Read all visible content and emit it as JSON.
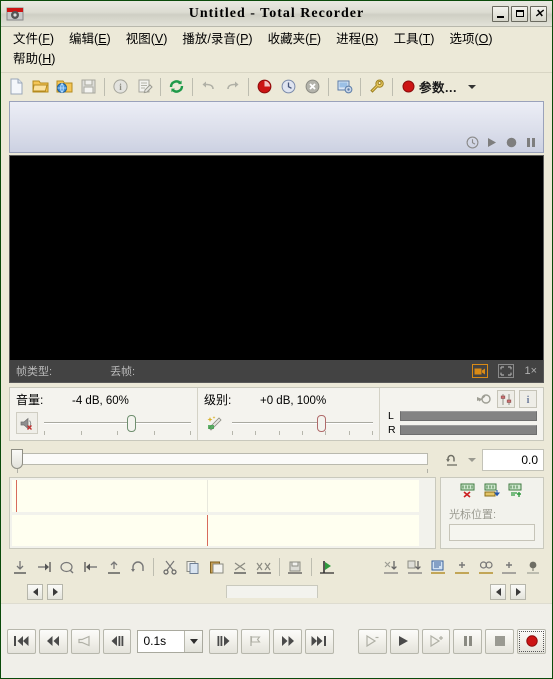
{
  "window": {
    "title": "Untitled - Total Recorder",
    "app_icon": "recorder-icon",
    "buttons": {
      "minimize": "_",
      "maximize": "□",
      "close": "✕"
    }
  },
  "menubar": {
    "items": [
      {
        "label": "文件",
        "accel": "F"
      },
      {
        "label": "编辑",
        "accel": "E"
      },
      {
        "label": "视图",
        "accel": "V"
      },
      {
        "label": "播放/录音",
        "accel": "P"
      },
      {
        "label": "收藏夹",
        "accel": "F"
      },
      {
        "label": "进程",
        "accel": "R"
      },
      {
        "label": "工具",
        "accel": "T"
      },
      {
        "label": "选项",
        "accel": "O"
      },
      {
        "label": "帮助",
        "accel": "H"
      }
    ]
  },
  "toolbar": {
    "buttons": [
      {
        "name": "new-file-icon"
      },
      {
        "name": "open-file-icon"
      },
      {
        "name": "open-web-icon"
      },
      {
        "name": "save-file-icon"
      },
      {
        "name": "file-info-icon"
      },
      {
        "name": "edit-properties-icon"
      },
      {
        "name": "refresh-convert-icon"
      },
      {
        "name": "undo-icon"
      },
      {
        "name": "redo-icon"
      },
      {
        "name": "record-settings-icon"
      },
      {
        "name": "schedule-clock-icon"
      },
      {
        "name": "cancel-icon"
      },
      {
        "name": "split-settings-icon"
      },
      {
        "name": "tools-wrench-icon"
      }
    ],
    "params_label": "参数...",
    "params_icon": "red-record-dot-icon",
    "params_caret": "chevron-down-icon"
  },
  "infostrip": {
    "icons": [
      "clock-icon",
      "play-icon",
      "record-icon",
      "pause-icon"
    ]
  },
  "video": {
    "frame_type_label": "帧类型:",
    "frame_type_value": "",
    "dropped_label": "丢帧:",
    "dropped_value": "",
    "camera_icon": "camera-icon",
    "fullscreen_icon": "fullscreen-icon",
    "zoom_level": "1×"
  },
  "volume": {
    "label": "音量:",
    "value": "-4 dB, 60%",
    "mute_icon": "speaker-muted-icon",
    "slider_percent": 60
  },
  "level": {
    "label": "级别:",
    "value": "+0 dB, 100%",
    "wand_icon": "magic-wand-icon",
    "slider_percent": 64
  },
  "meters": {
    "icons": [
      "link-channels-icon",
      "mixer-icon",
      "info-icon"
    ],
    "channels": [
      {
        "label": "L",
        "value": 0
      },
      {
        "label": "R",
        "value": 0
      }
    ]
  },
  "position": {
    "slider_percent": 0,
    "loop_icon": "loop-icon",
    "loop_caret": "chevron-down-icon",
    "time_value": "0.0"
  },
  "waveform": {
    "tracks": [
      {
        "name": "track-upper",
        "cursor_percent": 1
      },
      {
        "name": "track-lower",
        "cursor_percent": 48
      }
    ],
    "side_icons": [
      "delete-selection-icon",
      "insert-selection-icon",
      "copy-selection-icon"
    ],
    "cursor_label": "光标位置:",
    "cursor_value": ""
  },
  "edit_toolbar": {
    "buttons": [
      {
        "name": "go-to-start-icon"
      },
      {
        "name": "jump-forward-icon"
      },
      {
        "name": "select-region-icon"
      },
      {
        "name": "jump-back-icon"
      },
      {
        "name": "set-mark-start-icon"
      },
      {
        "name": "loop-region-icon"
      },
      {
        "name": "cut-icon"
      },
      {
        "name": "copy-icon"
      },
      {
        "name": "paste-icon"
      },
      {
        "name": "delete-selection-icon"
      },
      {
        "name": "delete-all-icon"
      },
      {
        "name": "save-selection-icon"
      },
      {
        "name": "play-marker-icon"
      },
      {
        "name": "mix-down-icon"
      },
      {
        "name": "mix-save-icon"
      },
      {
        "name": "properties-list-icon"
      },
      {
        "name": "add-region-icon"
      },
      {
        "name": "find-region-icon"
      },
      {
        "name": "add-marker-icon"
      },
      {
        "name": "balloon-icon"
      }
    ]
  },
  "scroll": {
    "left_arrow": "arrow-left-icon",
    "right_arrow": "arrow-right-icon"
  },
  "transport": {
    "buttons": [
      {
        "name": "skip-to-start-button",
        "icon": "skip-start-icon"
      },
      {
        "name": "rewind-button",
        "icon": "rewind-icon"
      },
      {
        "name": "horn-button",
        "icon": "horn-icon"
      },
      {
        "name": "step-back-button",
        "icon": "step-back-icon"
      }
    ],
    "speed_value": "0.1s",
    "speed_caret": "chevron-down-icon",
    "buttons2": [
      {
        "name": "step-forward-button",
        "icon": "step-forward-icon"
      },
      {
        "name": "mark-forward-button",
        "icon": "flag-icon"
      },
      {
        "name": "fast-forward-button",
        "icon": "fast-forward-icon"
      },
      {
        "name": "skip-to-end-button",
        "icon": "skip-end-icon"
      }
    ],
    "buttons3": [
      {
        "name": "play-from-mark-button",
        "icon": "play-from-mark-icon"
      },
      {
        "name": "play-button",
        "icon": "play-icon"
      },
      {
        "name": "play-to-mark-button",
        "icon": "play-to-mark-icon"
      },
      {
        "name": "pause-button",
        "icon": "pause-icon"
      },
      {
        "name": "stop-button",
        "icon": "stop-icon"
      },
      {
        "name": "record-button",
        "icon": "record-icon"
      }
    ]
  },
  "colors": {
    "face": "#ece9d8",
    "record_red": "#cc1414",
    "waveform_bg": "#fffff0",
    "cursor_red": "#d86b5c",
    "video_bg": "#000000",
    "video_bar": "#434343",
    "accent_orange": "#d98a16"
  }
}
